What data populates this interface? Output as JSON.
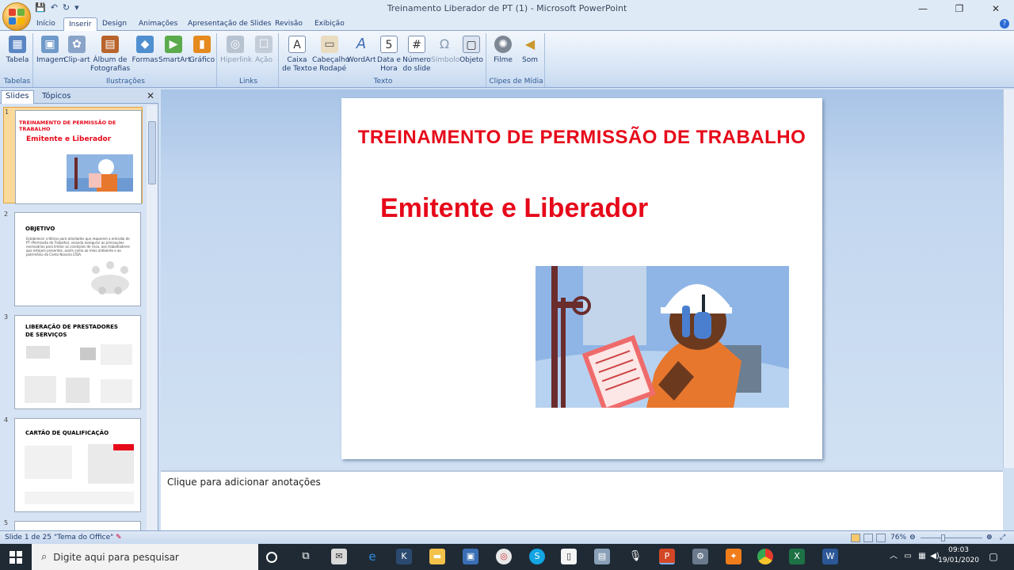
{
  "window": {
    "title": "Treinamento Liberador de PT (1) - Microsoft PowerPoint",
    "minimize": "—",
    "maximize": "❐",
    "close": "✕"
  },
  "tabs": [
    "Início",
    "Inserir",
    "Design",
    "Animações",
    "Apresentação de Slides",
    "Revisão",
    "Exibição"
  ],
  "ribbon": {
    "groups": {
      "tabelas": "Tabelas",
      "ilustracoes": "Ilustrações",
      "links": "Links",
      "texto": "Texto",
      "clipes": "Clipes de Mídia"
    },
    "buttons": {
      "tabela": "Tabela",
      "imagem": "Imagem",
      "clipart": "Clip-art",
      "album": "Álbum de Fotografias",
      "formas": "Formas",
      "smartart": "SmartArt",
      "grafico": "Gráfico",
      "hiperlink": "Hiperlink",
      "acao": "Ação",
      "caixa": "Caixa de Texto",
      "cabecalho": "Cabeçalho e Rodapé",
      "wordart": "WordArt",
      "data": "Data e Hora",
      "numero": "Número do slide",
      "simbolo": "Símbolo",
      "objeto": "Objeto",
      "filme": "Filme",
      "som": "Som"
    }
  },
  "panel": {
    "tab_slides": "Slides",
    "tab_topicos": "Tópicos",
    "close": "✕",
    "thumbs": [
      {
        "num": "1",
        "title": "TREINAMENTO DE PERMISSÃO DE TRABALHO",
        "subtitle": "Emitente e Liberador"
      },
      {
        "num": "2",
        "title": "OBJETIVO",
        "text": "Estabelecer critérios para atividades que requerem a emissão de PT (Permissão de Trabalho), visando assegurar as precauções necessárias para limitar as condições de risco, aos trabalhadores que estejam presentes, assim como ao meio ambiente e ao patrimônio do Cento Novaria LTDA."
      },
      {
        "num": "3",
        "title": "LIBERAÇÃO DE PRESTADORES DE SERVIÇOS"
      },
      {
        "num": "4",
        "title": "CARTÃO DE QUALIFICAÇÃO"
      },
      {
        "num": "5",
        "title": ""
      }
    ]
  },
  "slide": {
    "title": "TREINAMENTO DE PERMISSÃO DE TRABALHO",
    "subtitle": "Emitente e Liberador"
  },
  "notes": {
    "placeholder": "Clique para adicionar anotações"
  },
  "status": {
    "slide_count": "Slide 1 de 25",
    "theme": "\"Tema do Office\"",
    "zoom": "76%"
  },
  "taskbar": {
    "search_placeholder": "Digite aqui para pesquisar",
    "time": "09:03",
    "date": "19/01/2020"
  },
  "colors": {
    "accent_red": "#e6091a",
    "ribbon_blue": "#d6e4f5",
    "selected_thumb": "#fbd99b"
  }
}
